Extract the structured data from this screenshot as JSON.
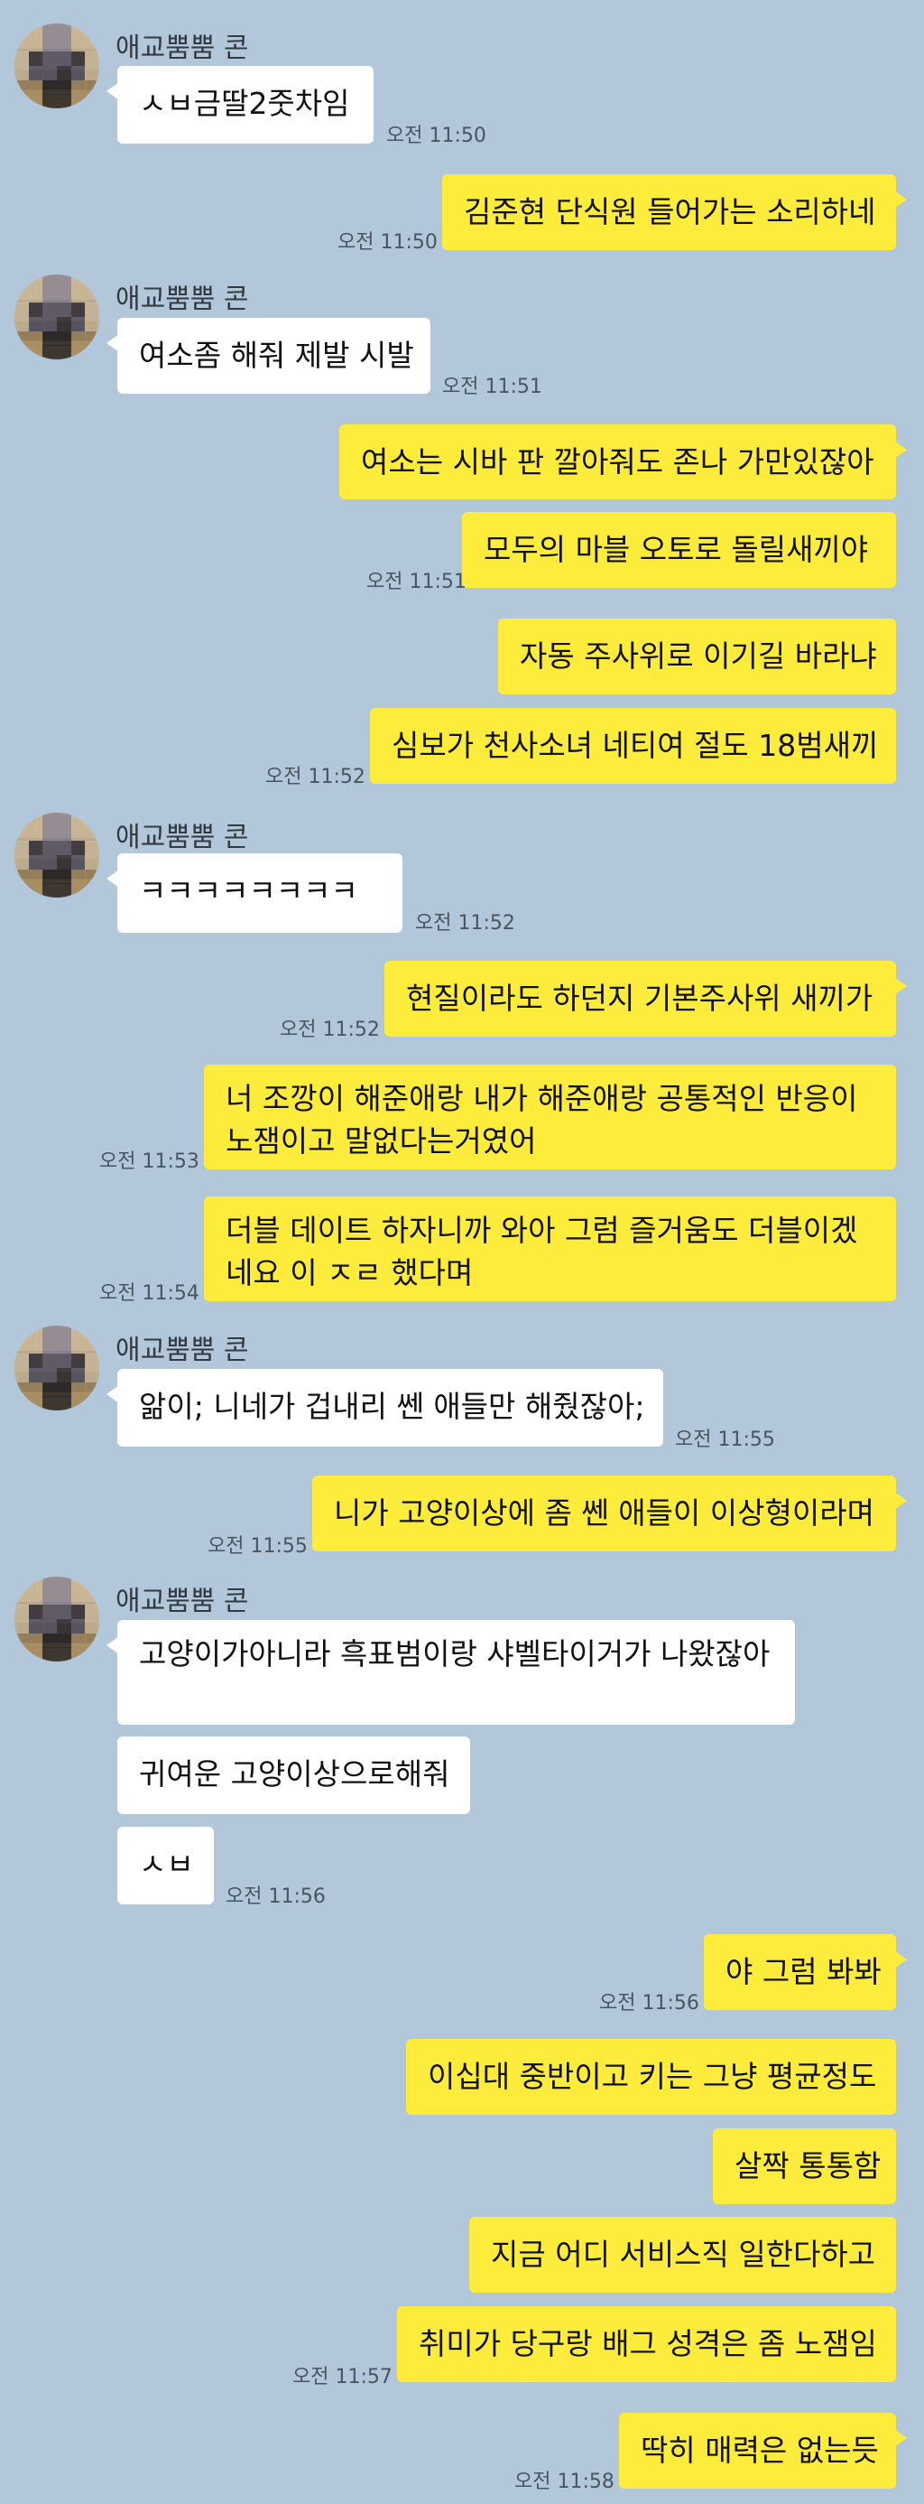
{
  "contact": {
    "name": "애교뿜뿜 콘"
  },
  "colors": {
    "background": "#b2c7da",
    "outgoing": "#fdec3b",
    "incoming": "#ffffff"
  },
  "messages": [
    {
      "dir": "in",
      "text": "ㅅㅂ금딸2줏차임",
      "time": "오전 11:50"
    },
    {
      "dir": "out",
      "text": "김준현 단식원 들어가는 소리하네",
      "time": "오전 11:50"
    },
    {
      "dir": "in",
      "text": "여소좀 해줘 제발 시발",
      "time": "오전 11:51"
    },
    {
      "dir": "out",
      "text": "여소는 시바 판 깔아줘도 존나 가만있잖아",
      "time": ""
    },
    {
      "dir": "out",
      "text": "모두의 마블 오토로 돌릴새끼야",
      "time": "오전 11:51"
    },
    {
      "dir": "out",
      "text": "자동 주사위로 이기길 바라냐",
      "time": ""
    },
    {
      "dir": "out",
      "text": "심보가 천사소녀 네티여 절도 18범새끼",
      "time": "오전 11:52"
    },
    {
      "dir": "in",
      "text": "ㅋㅋㅋㅋㅋㅋㅋㅋ",
      "time": "오전 11:52"
    },
    {
      "dir": "out",
      "text": "현질이라도 하던지 기본주사위 새끼가",
      "time": "오전 11:52"
    },
    {
      "dir": "out",
      "text": "너 조깡이 해준애랑 내가 해준애랑 공통적인 반응이 노잼이고 말없다는거였어",
      "time": "오전 11:53"
    },
    {
      "dir": "out",
      "text": "더블 데이트 하자니까 와아 그럼 즐거움도 더블이겠네요 이 ㅈㄹ 했다며",
      "time": "오전 11:54"
    },
    {
      "dir": "in",
      "text": "앎이; 니네가 겁내리 쎈 애들만 해줬잖아;",
      "time": "오전 11:55"
    },
    {
      "dir": "out",
      "text": "니가 고양이상에 좀 쎈 애들이 이상형이라며",
      "time": "오전 11:55"
    },
    {
      "dir": "in",
      "text": "고양이가아니라 흑표범이랑 샤벨타이거가 나왔잖아",
      "time": ""
    },
    {
      "dir": "in",
      "text": "귀여운 고양이상으로해줘",
      "time": ""
    },
    {
      "dir": "in",
      "text": "ㅅㅂ",
      "time": "오전 11:56"
    },
    {
      "dir": "out",
      "text": "야 그럼 봐봐",
      "time": "오전 11:56"
    },
    {
      "dir": "out",
      "text": "이십대 중반이고 키는 그냥 평균정도",
      "time": ""
    },
    {
      "dir": "out",
      "text": "살짝 통통함",
      "time": ""
    },
    {
      "dir": "out",
      "text": "지금 어디 서비스직 일한다하고",
      "time": ""
    },
    {
      "dir": "out",
      "text": "취미가 당구랑 배그 성격은 좀 노잼임",
      "time": "오전 11:57"
    },
    {
      "dir": "out",
      "text": "딱히 매력은 없는듯",
      "time": "오전 11:58"
    }
  ]
}
